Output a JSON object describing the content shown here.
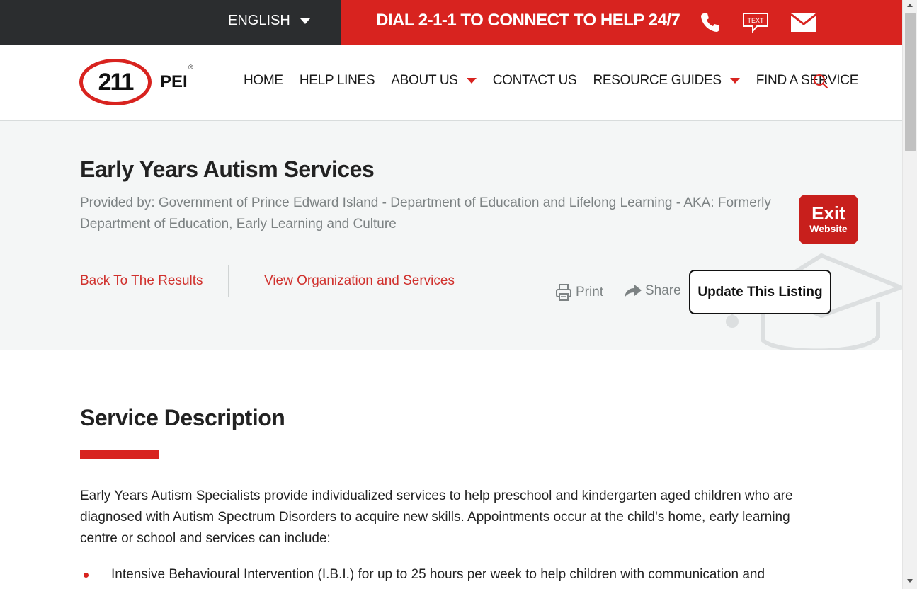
{
  "topbar": {
    "language": "ENGLISH",
    "dial_text": "DIAL 2-1-1 TO CONNECT TO HELP 24/7",
    "text_icon_label": "TEXT",
    "icons": [
      "phone-icon",
      "text-message-icon",
      "email-icon"
    ]
  },
  "logo": {
    "number": "211",
    "region": "PEI",
    "registered": "®"
  },
  "nav": {
    "items": [
      {
        "label": "HOME"
      },
      {
        "label": "HELP LINES"
      },
      {
        "label": "ABOUT US"
      },
      {
        "label": "CONTACT US"
      },
      {
        "label": "RESOURCE GUIDES"
      },
      {
        "label": "FIND A SERVICE"
      }
    ]
  },
  "listing": {
    "title": "Early Years Autism Services",
    "provider": "Provided by: Government of Prince Edward Island - Department of Education and Lifelong Learning - AKA: Formerly Department of Education, Early Learning and Culture",
    "back_link": "Back To The Results",
    "view_link": "View Organization and Services",
    "print_label": "Print",
    "share_label": "Share",
    "update_label": "Update This Listing"
  },
  "exit": {
    "big": "Exit",
    "small": "Website"
  },
  "description": {
    "heading": "Service Description",
    "body": "Early Years Autism Specialists provide individualized services to help preschool and kindergarten aged children who are diagnosed with Autism Spectrum Disorders to acquire new skills. Appointments occur at the child's home, early learning centre or school and services can include:",
    "bullets": [
      "Intensive Behavioural Intervention (I.B.I.) for up to 25 hours per week to help children with communication and"
    ]
  },
  "colors": {
    "brand_red": "#d8231f",
    "topbar_dark": "#2b2d2f",
    "hero_bg": "#f4f6f6",
    "muted_text": "#7c8283"
  }
}
